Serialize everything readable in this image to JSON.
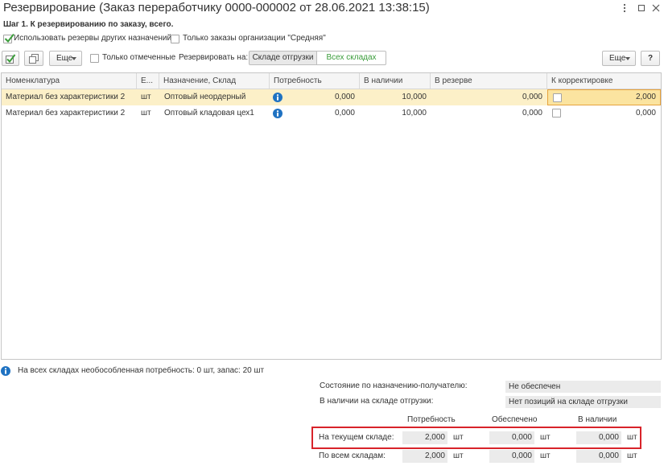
{
  "window": {
    "title": "Резервирование (Заказ переработчику 0000-000002 от 28.06.2021 13:38:15)"
  },
  "step_label": "Шаг 1. К резервированию по заказу, всего.",
  "options": {
    "use_other_reserves": {
      "label": "Использовать резервы других назначений",
      "checked": true
    },
    "only_org_orders": {
      "label": "Только заказы организации \"Средняя\"",
      "checked": false
    }
  },
  "toolbar": {
    "more_label": "Еще",
    "only_marked": {
      "label": "Только отмеченные",
      "checked": false
    },
    "reserve_on_label": "Резервировать на:",
    "reserve_on_options": [
      "Складе отгрузки",
      "Всех складах"
    ],
    "right_more_label": "Еще",
    "help_label": "?"
  },
  "table": {
    "columns": [
      "Номенклатура",
      "Е...",
      "Назначение, Склад",
      "Потребность",
      "В наличии",
      "В резерве",
      "К корректировке"
    ],
    "rows": [
      {
        "item": "Материал без характеристики 2",
        "unit": "шт",
        "destination": "Оптовый неордерный",
        "need": "0,000",
        "available": "10,000",
        "reserved": "0,000",
        "adjust_checked": false,
        "adjust": "2,000",
        "selected": true
      },
      {
        "item": "Материал без характеристики 2",
        "unit": "шт",
        "destination": "Оптовый кладовая цех1",
        "need": "0,000",
        "available": "10,000",
        "reserved": "0,000",
        "adjust_checked": false,
        "adjust": "0,000",
        "selected": false
      }
    ]
  },
  "info_line": "На всех складах необособленная потребность: 0 шт, запас: 20 шт",
  "summary": {
    "state_label": "Состояние по назначению-получателю:",
    "state_value": "Не обеспечен",
    "stock_label": "В наличии на складе отгрузки:",
    "stock_value": "Нет позиций на складе отгрузки",
    "columns": [
      "Потребность",
      "Обеспечено",
      "В наличии"
    ],
    "unit": "шт",
    "rows": [
      {
        "label": "На текущем складе:",
        "values": [
          "2,000",
          "0,000",
          "0,000"
        ],
        "highlighted": true
      },
      {
        "label": "По всем складам:",
        "values": [
          "2,000",
          "0,000",
          "0,000"
        ],
        "highlighted": false
      }
    ]
  },
  "icons": {
    "window_more": "more-vertical-icon",
    "window_maximize": "maximize-icon",
    "window_close": "close-icon",
    "mark_all": "checkbox-checked-icon",
    "unmark_all": "stacked-squares-icon",
    "info": "info-icon",
    "dropdown": "chevron-down-icon",
    "check": "check-icon"
  },
  "colors": {
    "text": "#333333",
    "title": "#333333",
    "accent_green": "#3a9c3a",
    "selected_row": "#fcf0c8",
    "active_cell": "#fbe4a0",
    "active_cell_border": "#e6a23c",
    "info_blue": "#1f72c2",
    "highlight_red": "#d8232a",
    "readonly_field": "#ebebeb"
  }
}
